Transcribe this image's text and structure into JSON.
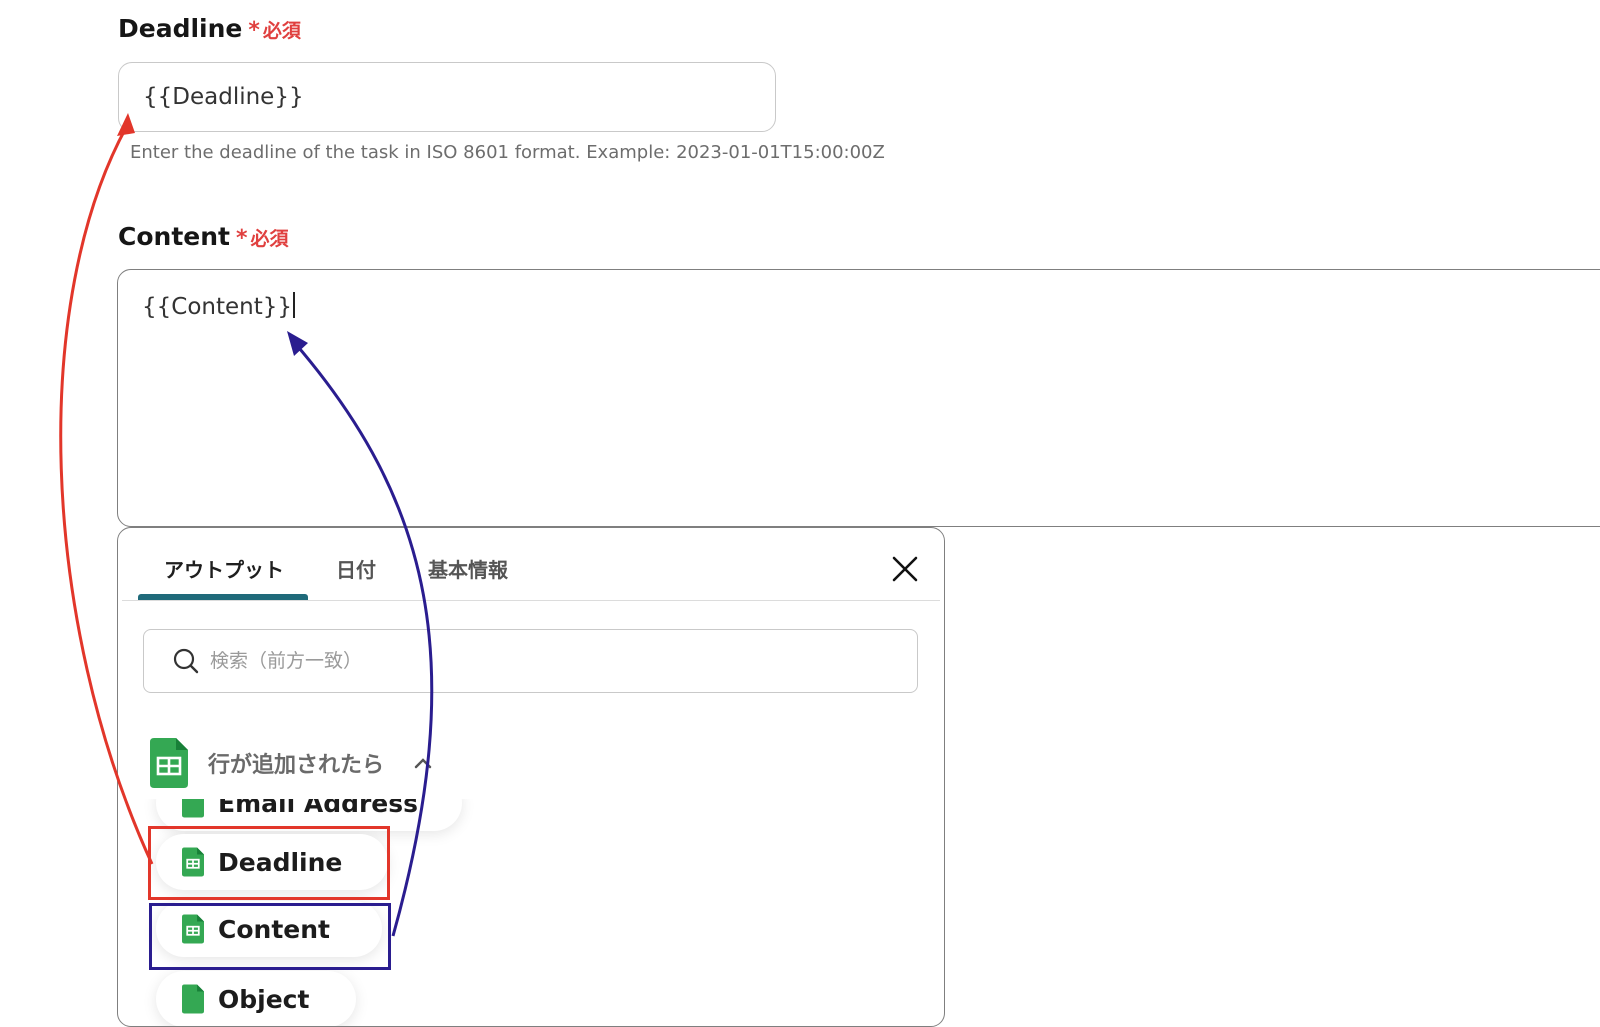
{
  "deadline_field": {
    "label": "Deadline",
    "required_mark": "*",
    "required_text": "必須",
    "value": "{{Deadline}}",
    "help_text": "Enter the deadline of the task in ISO 8601 format. Example: 2023-01-01T15:00:00Z"
  },
  "content_field": {
    "label": "Content",
    "required_mark": "*",
    "required_text": "必須",
    "value": "{{Content}}"
  },
  "picker": {
    "tabs": [
      {
        "label": "アウトプット",
        "active": true
      },
      {
        "label": "日付",
        "active": false
      },
      {
        "label": "基本情報",
        "active": false
      }
    ],
    "search_placeholder": "検索（前方一致）",
    "group_title": "行が追加されたら",
    "items": [
      {
        "label": "Email Address"
      },
      {
        "label": "Deadline"
      },
      {
        "label": "Content"
      },
      {
        "label": "Object"
      }
    ]
  },
  "colors": {
    "required": "#e0403f",
    "tab_indicator": "#1f6a7a",
    "sheets_green": "#34a853",
    "arrow_red": "#e2362a",
    "arrow_blue": "#2a1d8f"
  },
  "icons": [
    "search-icon",
    "close-icon",
    "google-sheets-icon",
    "chevron-up-icon"
  ]
}
